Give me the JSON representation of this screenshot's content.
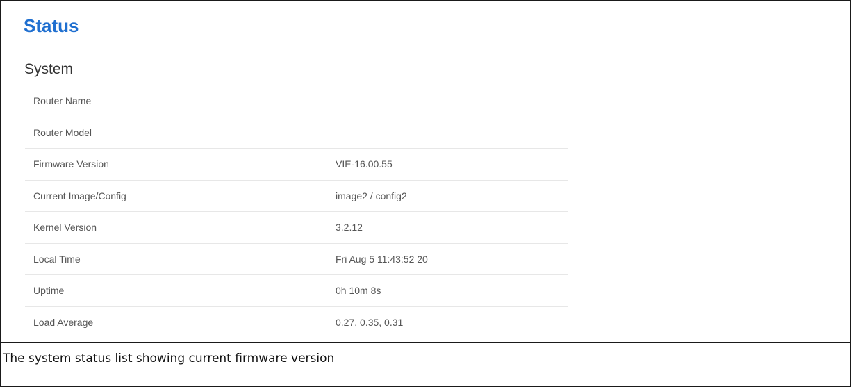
{
  "page": {
    "title": "Status",
    "section_title": "System"
  },
  "system_status": {
    "rows": [
      {
        "label": "Router Name",
        "value": ""
      },
      {
        "label": "Router Model",
        "value": ""
      },
      {
        "label": "Firmware Version",
        "value": "VIE-16.00.55"
      },
      {
        "label": "Current Image/Config",
        "value": "image2 / config2"
      },
      {
        "label": "Kernel Version",
        "value": "3.2.12"
      },
      {
        "label": "Local Time",
        "value": "Fri Aug 5 11:43:52 20"
      },
      {
        "label": "Uptime",
        "value": "0h 10m 8s"
      },
      {
        "label": "Load Average",
        "value": "0.27, 0.35, 0.31"
      }
    ]
  },
  "caption": "The system status list showing current firmware version",
  "colors": {
    "title": "#1f6fd0",
    "row_divider": "#e7e7e7",
    "text": "#555555",
    "frame": "#1a1a1a"
  }
}
